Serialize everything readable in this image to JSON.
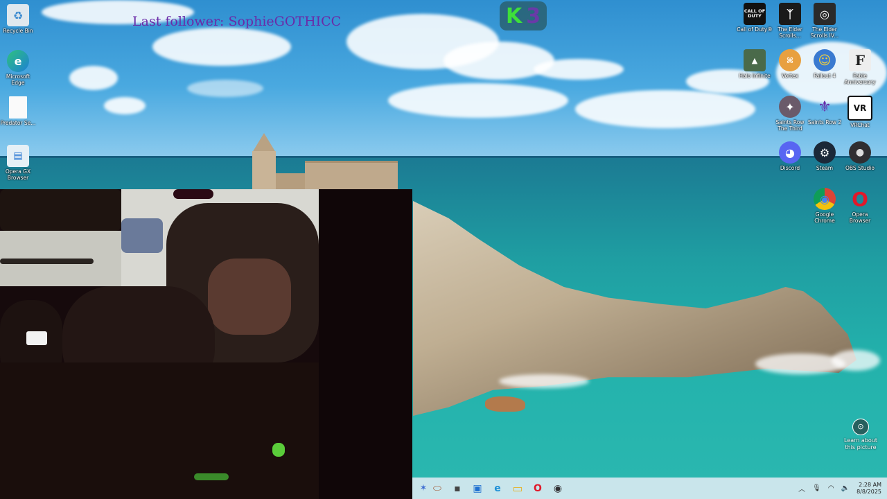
{
  "overlay": {
    "last_follower": "Last follower: SophieGOTHICC",
    "badge_k": "K",
    "badge_3": "3"
  },
  "desktop_left": [
    {
      "label": "Recycle Bin",
      "icon": "recycle-bin-icon"
    },
    {
      "label": "Microsoft Edge",
      "icon": "edge-icon"
    },
    {
      "label": "Predator Se...",
      "icon": "file-icon"
    },
    {
      "label": "Opera GX Browser",
      "icon": "opera-gx-icon"
    }
  ],
  "desktop_right": [
    {
      "label": "Call of Duty®",
      "icon": "call-of-duty-icon",
      "glyph": "CALL OF DUTY"
    },
    {
      "label": "The Elder Scrolls...",
      "icon": "elder-scrolls-icon",
      "glyph": "ᛉ"
    },
    {
      "label": "The Elder Scrolls IV...",
      "icon": "elder-scrolls-iv-icon",
      "glyph": "◎"
    },
    {
      "label": "Halo Infinite",
      "icon": "halo-infinite-icon",
      "glyph": "▲"
    },
    {
      "label": "Vortex",
      "icon": "vortex-icon",
      "glyph": "⌘"
    },
    {
      "label": "Fallout 4",
      "icon": "fallout-4-icon",
      "glyph": "☺"
    },
    {
      "label": "Fable Anniversary",
      "icon": "fable-icon",
      "glyph": "F"
    },
    {
      "label": "Saints Row The Third",
      "icon": "saints-row-third-icon",
      "glyph": "✦"
    },
    {
      "label": "Saints Row 2",
      "icon": "saints-row-2-icon",
      "glyph": "⚜"
    },
    {
      "label": "VRChat",
      "icon": "vrchat-icon",
      "glyph": "VR"
    },
    {
      "label": "Discord",
      "icon": "discord-icon",
      "glyph": "◕"
    },
    {
      "label": "Steam",
      "icon": "steam-icon",
      "glyph": "⚙"
    },
    {
      "label": "OBS Studio",
      "icon": "obs-icon",
      "glyph": "●"
    },
    {
      "label": "Google Chrome",
      "icon": "chrome-icon",
      "glyph": "◉"
    },
    {
      "label": "Opera Browser",
      "icon": "opera-icon",
      "glyph": "O"
    }
  ],
  "learn": {
    "label": "Learn about this picture",
    "icon": "camera-icon"
  },
  "taskbar": {
    "apps": [
      {
        "name": "pinned-app-icon",
        "glyph": "✶"
      },
      {
        "name": "rugby-app-icon",
        "glyph": "⬭"
      },
      {
        "name": "window-app-icon",
        "glyph": "▪"
      },
      {
        "name": "blue-app-icon",
        "glyph": "▣"
      },
      {
        "name": "edge-taskbar-icon",
        "glyph": "e"
      },
      {
        "name": "file-explorer-icon",
        "glyph": "▭"
      },
      {
        "name": "opera-taskbar-icon",
        "glyph": "O"
      },
      {
        "name": "obs-taskbar-icon",
        "glyph": "◉"
      }
    ],
    "time": "2:28 AM",
    "date": "8/8/2025"
  },
  "colors": {
    "follower_text": "#6a2aa8",
    "badge_k": "#3ee03a",
    "badge_3": "#6a3aa8",
    "taskbar_bg": "#d7e8f0"
  }
}
